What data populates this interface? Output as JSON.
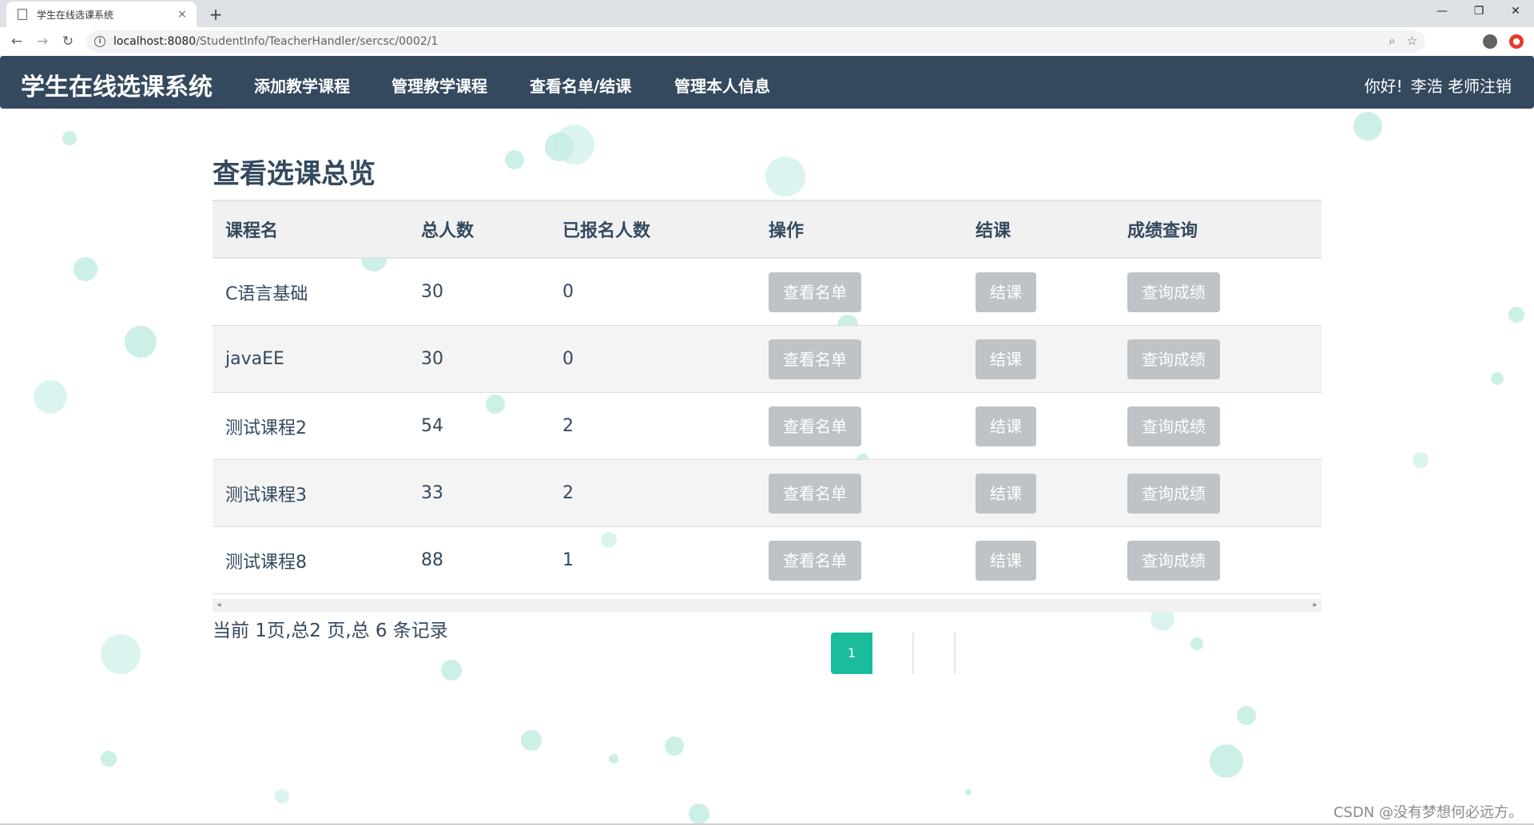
{
  "browser": {
    "tab_title": "学生在线选课系统",
    "tab_close": "×",
    "new_tab": "+",
    "url_host": "localhost:8080",
    "url_path": "/StudentInfo/TeacherHandler/sercsc/0002/1",
    "window_controls": [
      "—",
      "❐",
      "✕"
    ]
  },
  "nav": {
    "brand": "学生在线选课系统",
    "links": [
      "添加教学课程",
      "管理教学课程",
      "查看名单/结课",
      "管理本人信息"
    ],
    "greeting": "你好!",
    "user": "李浩 老师",
    "logout": "注销"
  },
  "main": {
    "title": "查看选课总览",
    "columns": [
      "课程名",
      "总人数",
      "已报名人数",
      "操作",
      "结课",
      "成绩查询"
    ],
    "rows": [
      {
        "name": "C语言基础",
        "total": "30",
        "enrolled": "0"
      },
      {
        "name": "javaEE",
        "total": "30",
        "enrolled": "0"
      },
      {
        "name": "测试课程2",
        "total": "54",
        "enrolled": "2"
      },
      {
        "name": "测试课程3",
        "total": "33",
        "enrolled": "2"
      },
      {
        "name": "测试课程8",
        "total": "88",
        "enrolled": "1"
      }
    ],
    "btn_view": "查看名单",
    "btn_close": "结课",
    "btn_score": "查询成绩",
    "page_info": "当前 1页,总2 页,总 6 条记录",
    "current_page": "1"
  },
  "watermark": "CSDN @没有梦想何必远方。",
  "colors": {
    "nav_bg": "#34495e",
    "accent": "#1abc9c",
    "button_gray": "#bdc3c7",
    "bubble": "#8fdccd"
  }
}
